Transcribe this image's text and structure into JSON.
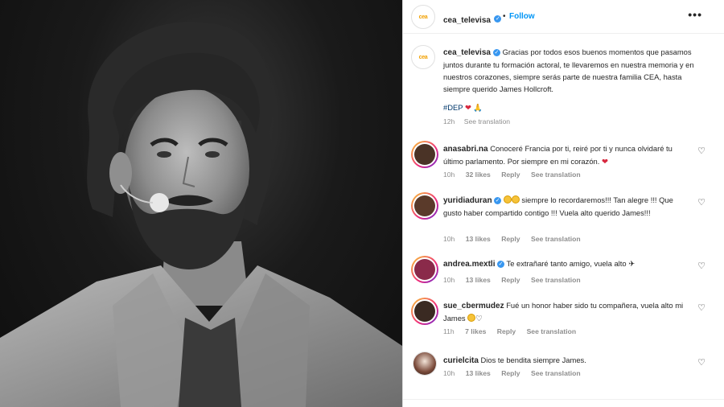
{
  "post": {
    "username": "cea_televisa",
    "follow_label": "Follow",
    "more_label": "•••",
    "caption_text": "Gracias por todos esos buenos momentos que pasamos juntos durante tu formación actoral, te llevaremos en nuestra memoria y en nuestros corazones, siempre serás parte de nuestra familia CEA, hasta siempre querido James Hollcroft.",
    "hashtag": "#DEP",
    "time": "12h",
    "see_translation": "See translation",
    "logo_text": "cea",
    "verified_mark": "✓"
  },
  "comments": [
    {
      "username": "anasabri.na",
      "text": "Conoceré Francia por ti, reiré por ti y nunca olvidaré tu último parlamento. Por siempre en mi corazón.",
      "emoji": "❤",
      "time": "10h",
      "likes": "32 likes",
      "reply": "Reply",
      "translation": "See translation",
      "verified": false
    },
    {
      "username": "yuridiaduran",
      "text": "siempre lo recordaremos!!! Tan alegre !!! Que gusto haber compartido contigo !!! Vuela alto querido James!!!",
      "time": "10h",
      "likes": "13 likes",
      "reply": "Reply",
      "translation": "See translation",
      "verified": true
    },
    {
      "username": "andrea.mextli",
      "text": "Te extrañaré tanto amigo, vuela alto",
      "emoji": "✈",
      "time": "10h",
      "likes": "13 likes",
      "reply": "Reply",
      "translation": "See translation",
      "verified": true
    },
    {
      "username": "sue_cbermudez",
      "text": "Fué un honor haber sido tu compañera, vuela alto mi James",
      "emoji": "♡",
      "time": "11h",
      "likes": "7 likes",
      "reply": "Reply",
      "translation": "See translation",
      "verified": false
    },
    {
      "username": "curielcita",
      "text": "Dios te bendita siempre James.",
      "time": "10h",
      "likes": "13 likes",
      "reply": "Reply",
      "translation": "See translation",
      "verified": false
    }
  ],
  "icons": {
    "heart": "♡",
    "pray": "🙏"
  },
  "colors": {
    "accent_blue": "#0095f6",
    "verified_blue": "#3897f0",
    "heart_red": "#d7263d",
    "muted": "#8e8e8e"
  }
}
